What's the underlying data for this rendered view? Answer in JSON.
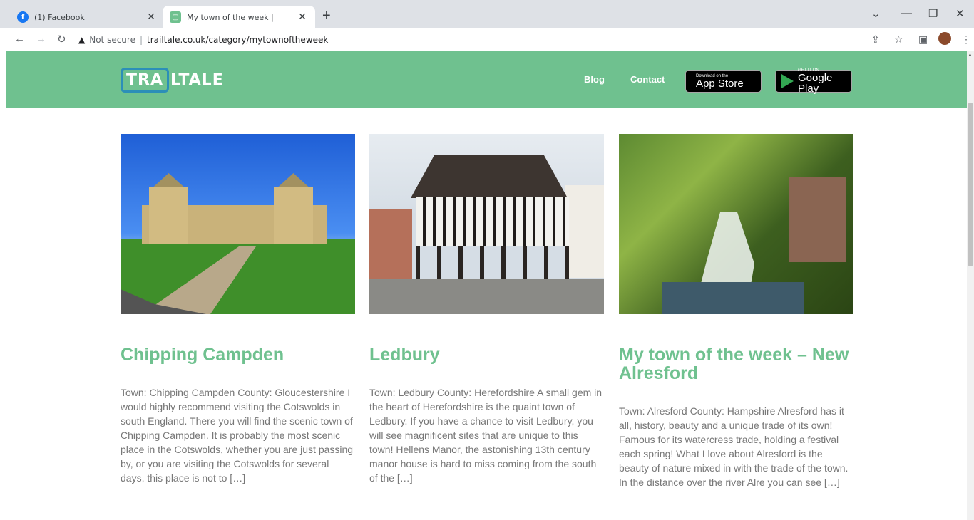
{
  "browser": {
    "tabs": [
      {
        "title": "(1) Facebook",
        "active": false,
        "favicon": "facebook-icon"
      },
      {
        "title": "My town of the week |",
        "active": true,
        "favicon": "trailtale-icon"
      }
    ],
    "security_label": "Not secure",
    "url": "trailtale.co.uk/category/mytownoftheweek"
  },
  "site": {
    "logo_boxed": "TRA",
    "logo_rest": "LTALE",
    "nav": {
      "blog": "Blog",
      "contact": "Contact"
    },
    "app_store": {
      "small": "Download on the",
      "big": "App Store"
    },
    "google_play": {
      "small": "GET IT ON",
      "big": "Google Play"
    },
    "brand_color": "#6fc18f"
  },
  "posts": [
    {
      "title": "Chipping Campden",
      "excerpt": "Town: Chipping Campden County: Gloucestershire I would highly recommend visiting the Cotswolds in south England. There you will find the scenic town of Chipping Campden. It is probably the most scenic place in the Cotswolds, whether you are just passing by, or you are visiting the Cotswolds for several days, this place is not to […]"
    },
    {
      "title": "Ledbury",
      "excerpt": "Town: Ledbury County: Herefordshire A small gem in the heart of Herefordshire is the quaint town of Ledbury. If you have a chance to visit Ledbury, you will see magnificent sites that are unique to this town! Hellens Manor, the astonishing 13th century manor house is hard to miss coming from the south of the […]"
    },
    {
      "title": "My town of the week – New Alresford",
      "excerpt": "Town: Alresford County: Hampshire Alresford has it all, history, beauty and a unique trade of its own! Famous for its watercress trade, holding a festival each spring! What I love about Alresford is the beauty of nature mixed in with the trade of the town. In the distance over the river Alre you can see […]"
    }
  ]
}
